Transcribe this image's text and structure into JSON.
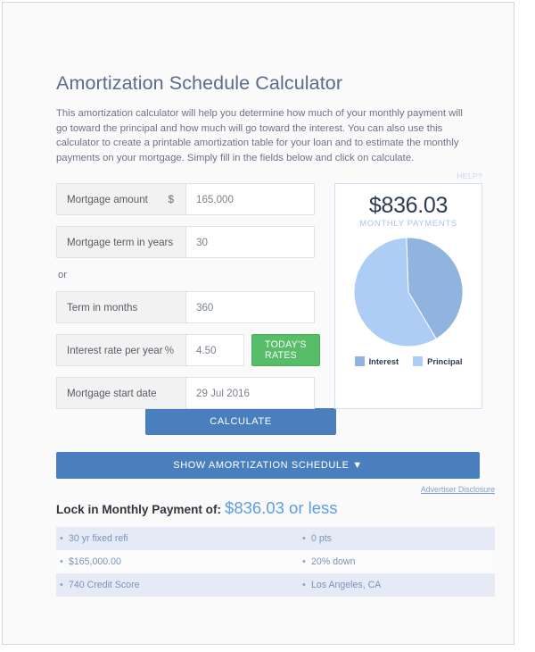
{
  "page": {
    "title": "Amortization Schedule Calculator",
    "intro": "This amortization calculator will help you determine how much of your monthly payment will go toward the principal and how much will go toward the interest. You can also use this calculator to create a printable amortization table for your loan and to estimate the monthly payments on your mortgage. Simply fill in the fields below and click on calculate."
  },
  "form": {
    "or_text": "or",
    "fields": [
      {
        "label": "Mortgage amount",
        "unit": "$",
        "value": "165,000"
      },
      {
        "label": "Mortgage term in years",
        "unit": "",
        "value": "30"
      },
      {
        "label": "Term in months",
        "unit": "",
        "value": "360"
      },
      {
        "label": "Interest rate per year",
        "unit": "%",
        "value": "4.50"
      },
      {
        "label": "Mortgage start date",
        "unit": "",
        "value": "29 Jul 2016"
      }
    ],
    "todays_rates_label": "TODAY'S RATES",
    "calculate_label": "CALCULATE",
    "show_schedule_label": "SHOW AMORTIZATION SCHEDULE ▼"
  },
  "summary": {
    "help_label": "HELP?",
    "monthly_payment": "$836.03",
    "monthly_payment_caption": "MONTHLY PAYMENTS"
  },
  "chart_data": {
    "type": "pie",
    "title": "$836.03 MONTHLY PAYMENTS",
    "labels": [
      "Interest",
      "Principal"
    ],
    "values": [
      42,
      58
    ],
    "unit": "percent",
    "colors": [
      "#91b3e0",
      "#aecdf5"
    ],
    "legend_position": "bottom",
    "start_angle": -2
  },
  "offers": {
    "disclosure_label": "Advertiser Disclosure",
    "lock_label": "Lock in Monthly Payment of:",
    "lock_amount": "$836.03 or less",
    "rows": [
      {
        "left": "30 yr fixed refi",
        "right": "0 pts"
      },
      {
        "left": "$165,000.00",
        "right": "20% down"
      },
      {
        "left": "740 Credit Score",
        "right": "Los Angeles, CA"
      }
    ]
  }
}
